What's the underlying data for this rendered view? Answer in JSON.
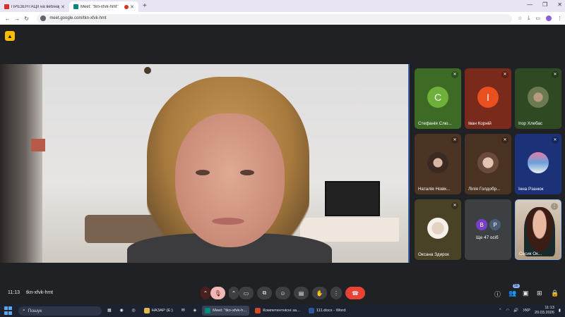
{
  "browser": {
    "tabs": [
      {
        "title": "ПРЕЗЕНТАЦІЇ на вебінар ТН",
        "favicon_color": "#d93025"
      },
      {
        "title": "Meet: \"tkn-xfvk-hmt\"",
        "favicon_color": "#00897b"
      }
    ],
    "new_tab": "+",
    "url": "meet.google.com/tkn-xfvk-hmt"
  },
  "meeting": {
    "time": "11:13",
    "code": "tkn-xfvk-hmt",
    "participants_badge": "56"
  },
  "participants": [
    {
      "name": "Стефанія Слю...",
      "initial": "С",
      "type": "initial",
      "bg": "#3d6a24",
      "avatar_color": "#6fb03a"
    },
    {
      "name": "Іван Корній",
      "initial": "І",
      "type": "initial",
      "bg": "#7a2a1a",
      "avatar_color": "#e8501f"
    },
    {
      "name": "Ігор Хлебас",
      "type": "photo",
      "bg": "#2f4a22",
      "avatar_color": "#6a7b52"
    },
    {
      "name": "Наталія Новік...",
      "type": "photo",
      "bg": "#4b3424",
      "avatar_color": "#8b6a55"
    },
    {
      "name": "Лілія Голдобр...",
      "type": "photo",
      "bg": "#4a3222",
      "avatar_color": "#b08670"
    },
    {
      "name": "Інна Рзанюк",
      "type": "photo",
      "bg": "#1b3278",
      "avatar_color": "#6aa0d8"
    },
    {
      "name": "Оксана Здирок",
      "type": "photo",
      "bg": "#4a4227",
      "avatar_color": "#e3d2c0"
    },
    {
      "name": "Ще 47 осіб",
      "type": "more",
      "bg": "#3c4043",
      "mini": [
        {
          "letter": "В",
          "color": "#7a3fc8"
        },
        {
          "letter": "Р",
          "color": "#4a5d74"
        }
      ]
    },
    {
      "name": "Сесик Ок...",
      "type": "video",
      "bg": "#c0a890",
      "avatar_color": "#6b3a2a"
    }
  ],
  "taskbar": {
    "search_placeholder": "Пошук",
    "apps": [
      {
        "label": "НАЗАР (E:)",
        "color": "#e0b84a"
      },
      {
        "label": "Meet: \"tkn-xfvk-h...",
        "color": "#00897b"
      },
      {
        "label": "Компетентнісні за...",
        "color": "#d24726"
      },
      {
        "label": "111.docx - Word",
        "color": "#2b579a"
      }
    ],
    "lang": "УКР",
    "time": "11:13",
    "date": "20.03.2026"
  },
  "icons": {
    "mic_off": "mic-off-icon",
    "camera": "camera-icon",
    "present": "present-icon",
    "emoji": "emoji-icon",
    "captions": "captions-icon",
    "hand": "raise-hand-icon",
    "more": "more-vert-icon",
    "end_call": "end-call-icon",
    "info": "info-icon",
    "people": "people-icon",
    "chat": "chat-icon",
    "activities": "activities-icon",
    "lock": "lock-icon"
  }
}
